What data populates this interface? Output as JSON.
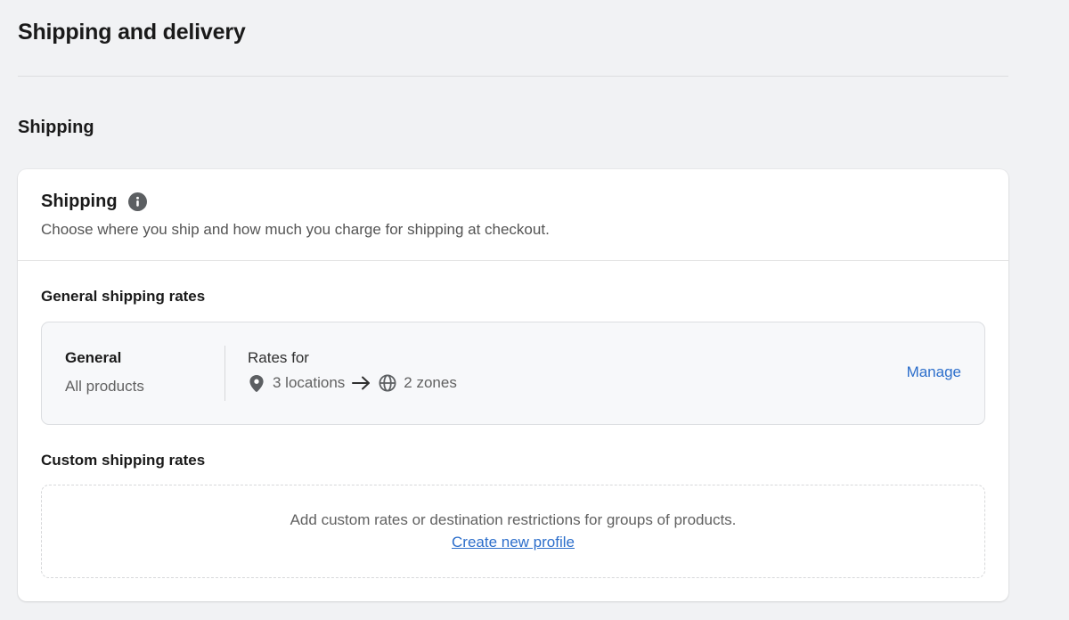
{
  "page": {
    "title": "Shipping and delivery",
    "section_title": "Shipping"
  },
  "card": {
    "title": "Shipping",
    "description": "Choose where you ship and how much you charge for shipping at checkout.",
    "general_heading": "General shipping rates",
    "general_profile": {
      "name": "General",
      "products": "All products",
      "rates_label": "Rates for",
      "locations": "3 locations",
      "zones": "2 zones",
      "manage_label": "Manage"
    },
    "custom_heading": "Custom shipping rates",
    "custom_empty": {
      "description": "Add custom rates or destination restrictions for groups of products.",
      "create_label": "Create new profile"
    }
  },
  "icons": {
    "info": "info-icon",
    "location": "location-pin-icon",
    "arrow": "arrow-right-icon",
    "globe": "globe-icon"
  },
  "colors": {
    "background": "#f1f2f4",
    "link": "#2c6ecb",
    "text": "#303030",
    "muted": "#616161"
  }
}
